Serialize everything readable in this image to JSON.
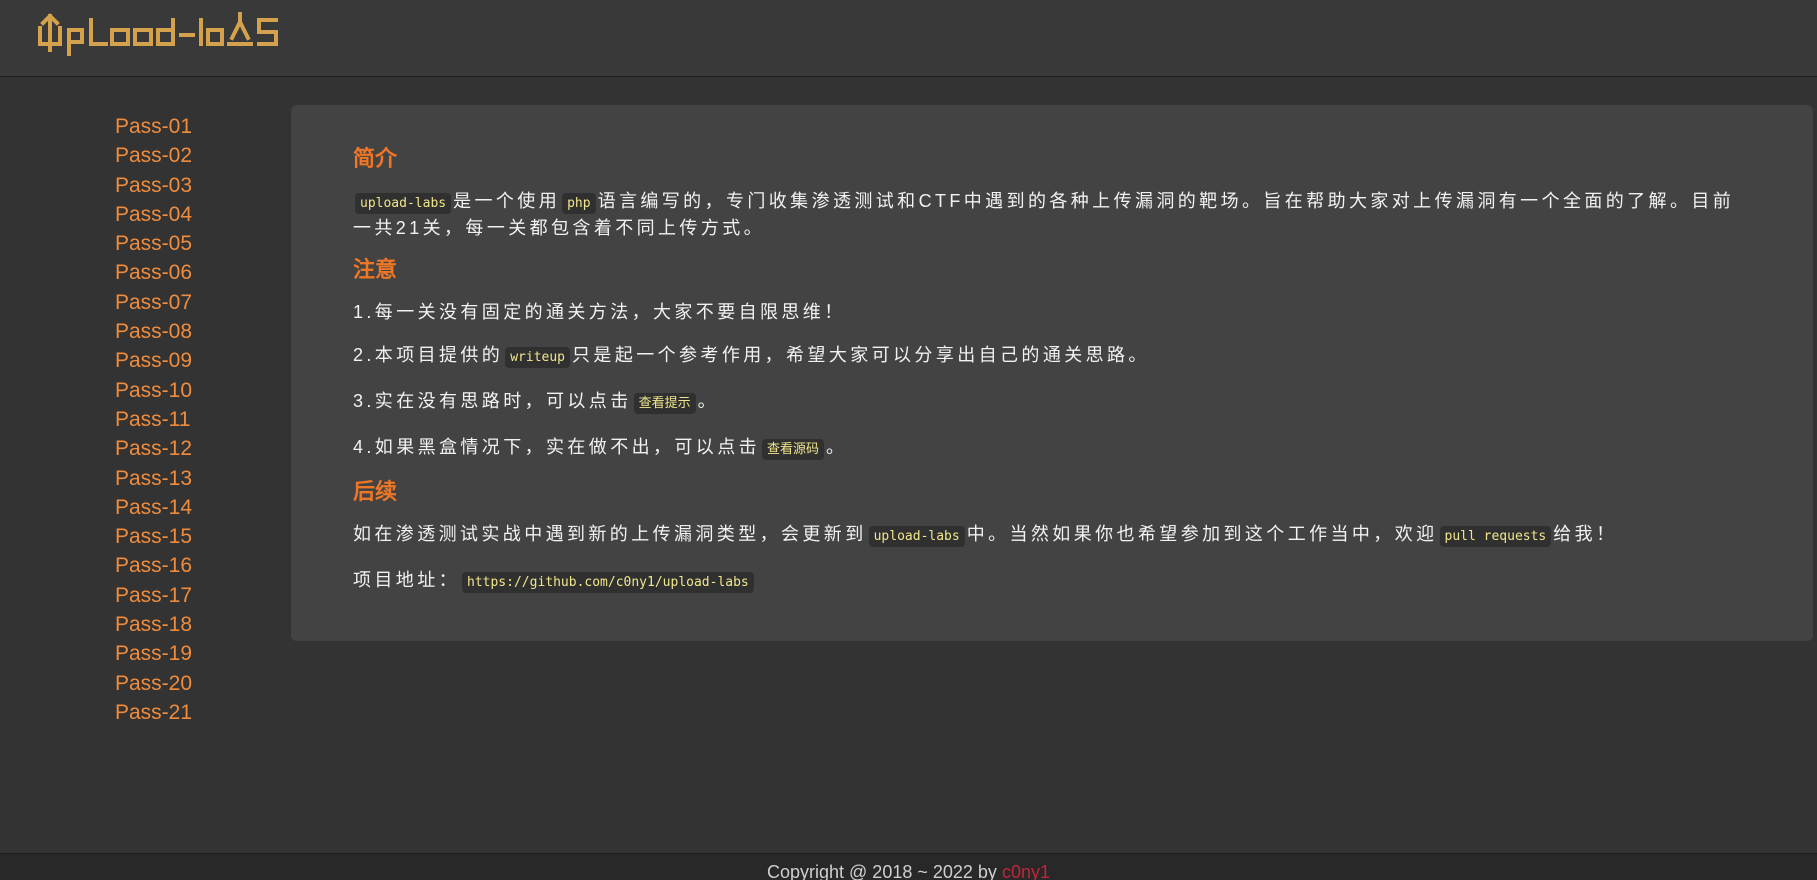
{
  "header": {
    "logo_text": "Upload-labs"
  },
  "sidebar": {
    "items": [
      {
        "label": "Pass-01"
      },
      {
        "label": "Pass-02"
      },
      {
        "label": "Pass-03"
      },
      {
        "label": "Pass-04"
      },
      {
        "label": "Pass-05"
      },
      {
        "label": "Pass-06"
      },
      {
        "label": "Pass-07"
      },
      {
        "label": "Pass-08"
      },
      {
        "label": "Pass-09"
      },
      {
        "label": "Pass-10"
      },
      {
        "label": "Pass-11"
      },
      {
        "label": "Pass-12"
      },
      {
        "label": "Pass-13"
      },
      {
        "label": "Pass-14"
      },
      {
        "label": "Pass-15"
      },
      {
        "label": "Pass-16"
      },
      {
        "label": "Pass-17"
      },
      {
        "label": "Pass-18"
      },
      {
        "label": "Pass-19"
      },
      {
        "label": "Pass-20"
      },
      {
        "label": "Pass-21"
      }
    ]
  },
  "intro": {
    "title": "简介",
    "code_project": "upload-labs",
    "text_1": "是一个使用",
    "code_php": "php",
    "text_2": "语言编写的，专门收集渗透测试和CTF中遇到的各种上传漏洞的靶场。旨在帮助大家对上传漏洞有一个全面的了解。目前一共21关，每一关都包含着不同上传方式。"
  },
  "notice": {
    "title": "注意",
    "item1": "1.每一关没有固定的通关方法，大家不要自限思维！",
    "item2_prefix": "2.本项目提供的",
    "item2_code": "writeup",
    "item2_suffix": "只是起一个参考作用，希望大家可以分享出自己的通关思路。",
    "item3_prefix": "3.实在没有思路时，可以点击",
    "item3_code": "查看提示",
    "item3_suffix": "。",
    "item4_prefix": "4.如果黑盒情况下，实在做不出，可以点击",
    "item4_code": "查看源码",
    "item4_suffix": "。"
  },
  "followup": {
    "title": "后续",
    "text_1": "如在渗透测试实战中遇到新的上传漏洞类型，会更新到",
    "code_project": "upload-labs",
    "text_2": "中。当然如果你也希望参加到这个工作当中，欢迎",
    "code_pr": "pull requests",
    "text_3": "给我！",
    "address_label": "项目地址：",
    "address_url": "https://github.com/c0ny1/upload-labs"
  },
  "footer": {
    "copyright": "Copyright @ 2018 ~ 2022 by",
    "author": "c0ny1"
  },
  "colors": {
    "accent": "#ee7625",
    "link": "#f08c3c",
    "code_text": "#f0e68c"
  }
}
